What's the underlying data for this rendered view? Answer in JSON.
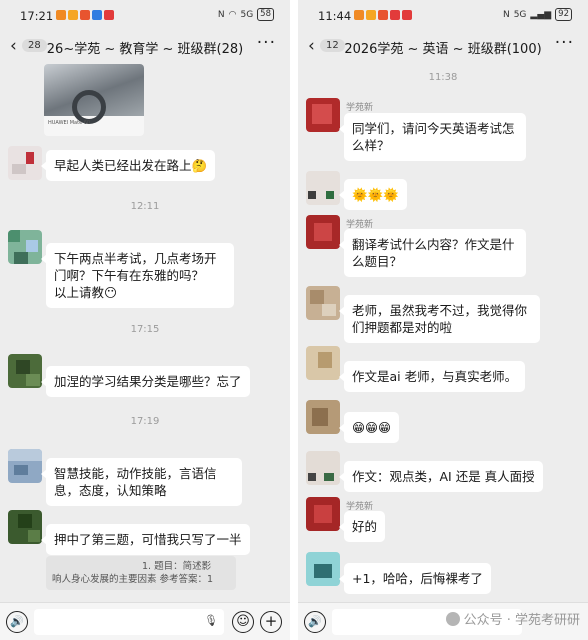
{
  "left": {
    "status": {
      "time": "17:21",
      "battery": "58",
      "signal": "5G"
    },
    "header": {
      "back_count": "28",
      "title": "26~学苑 ~ 教育学 ~ 班级群(28)",
      "more": "···"
    },
    "image_caption": "HUAWEI Mate 60",
    "messages": [
      {
        "text": "早起人类已经出发在路上🤔"
      },
      {
        "timestamp": "12:11"
      },
      {
        "text": "下午两点半考试，几点考场开门啊？下午有在东雅的吗？\n以上请教😶"
      },
      {
        "timestamp": "17:15"
      },
      {
        "text": "加涅的学习结果分类是哪些？忘了"
      },
      {
        "timestamp": "17:19"
      },
      {
        "text": "智慧技能，动作技能，言语信息，态度，认知策略"
      },
      {
        "text": "押中了第三题，可惜我只写了一半"
      }
    ],
    "quote": {
      "line1": "1. 题目：简述影",
      "line2": "响人身心发展的主要因素  参考答案：1"
    }
  },
  "right": {
    "status": {
      "time": "11:44",
      "battery": "92",
      "signal": "5G"
    },
    "header": {
      "back_count": "12",
      "title": "2026学苑 ~ 英语 ~ 班级群(100)",
      "more": "···"
    },
    "messages": [
      {
        "timestamp": "11:38"
      },
      {
        "sender": "学苑新",
        "text": "同学们，请问今天英语考试怎么样？"
      },
      {
        "text": "🌞🌞🌞"
      },
      {
        "sender": "学苑新",
        "text": "翻译考试什么内容？作文是什么题目？"
      },
      {
        "text": "老师，虽然我考不过，我觉得你们押题都是对的啦"
      },
      {
        "text": "作文是ai 老师，与真实老师。"
      },
      {
        "text": "😁😁😁"
      },
      {
        "text": "作文：观点类，AI 还是 真人面授"
      },
      {
        "sender": "学苑新",
        "text": "好的"
      },
      {
        "text": "+1，哈哈，后悔裸考了"
      }
    ],
    "watermark": "公众号 · 学苑考研研"
  },
  "icons": {
    "back": "‹",
    "voice": "🔊",
    "emoji": "☺",
    "plus": "+",
    "mic": "🎙"
  }
}
